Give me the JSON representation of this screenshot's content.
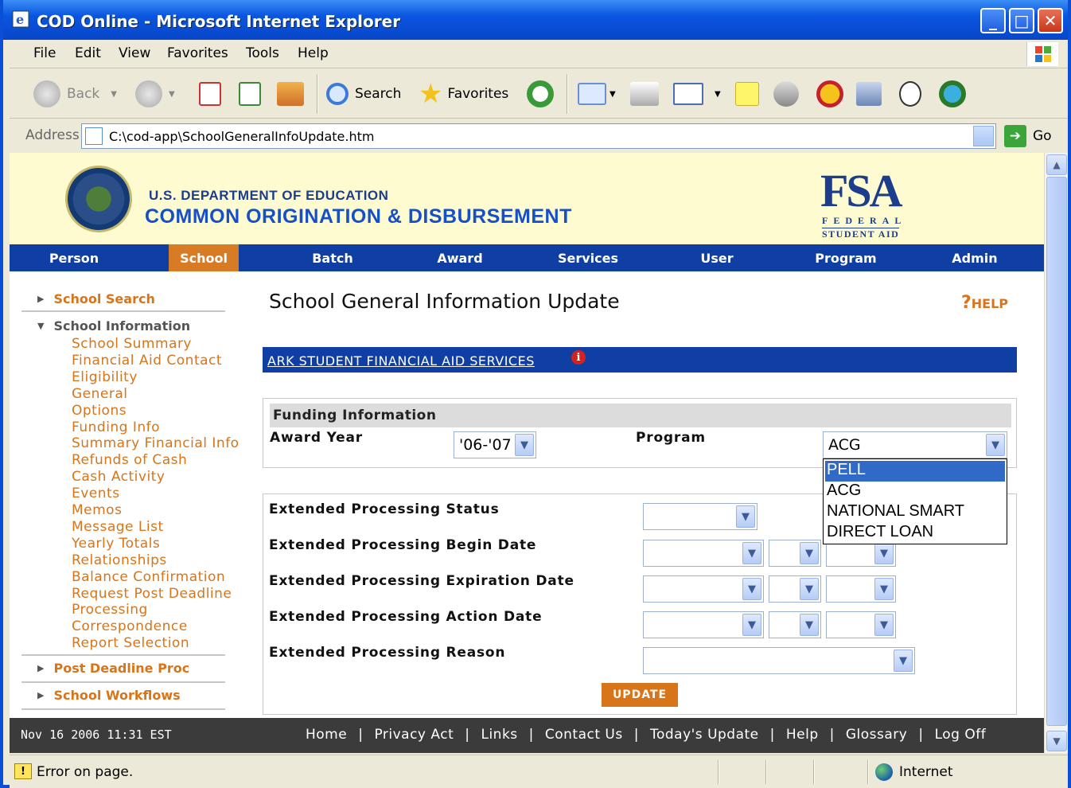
{
  "window": {
    "title": "COD Online - Microsoft Internet Explorer"
  },
  "menu": [
    "File",
    "Edit",
    "View",
    "Favorites",
    "Tools",
    "Help"
  ],
  "toolbar": {
    "back": "Back",
    "search": "Search",
    "favorites": "Favorites"
  },
  "address": {
    "label": "Address",
    "url": "C:\\cod-app\\SchoolGeneralInfoUpdate.htm",
    "go": "Go"
  },
  "banner": {
    "dept": "U.S. DEPARTMENT OF EDUCATION",
    "cod": "COMMON ORIGINATION & DISBURSEMENT",
    "fsa_big": "FSA",
    "fsa_federal": "FEDERAL",
    "fsa_student_aid": "STUDENT AID"
  },
  "nav": [
    "Person",
    "School",
    "Batch",
    "Award",
    "Services",
    "User",
    "Program",
    "Admin"
  ],
  "sidebar": {
    "school_search": "School Search",
    "school_information": "School Information",
    "items": [
      "School Summary",
      "Financial Aid Contact",
      "Eligibility",
      "General",
      "Options",
      "Funding Info",
      "Summary Financial Info",
      "Refunds of Cash",
      "Cash Activity",
      "Events",
      "Memos",
      "Message List",
      "Yearly Totals",
      "Relationships",
      "Balance Confirmation",
      "Request Post Deadline",
      "Processing",
      "Correspondence",
      "Report Selection"
    ],
    "post_deadline": "Post Deadline Proc",
    "school_workflows": "School Workflows"
  },
  "main": {
    "title": "School General Information Update",
    "help": "HELP",
    "school_name": "ARK STUDENT FINANCIAL AID SERVICES",
    "funding_header": "Funding Information",
    "award_year_label": "Award Year",
    "award_year_value": "'06-'07",
    "program_label": "Program",
    "program_value": "ACG",
    "program_options": [
      "PELL",
      "ACG",
      "NATIONAL SMART",
      "DIRECT LOAN"
    ],
    "ep_status": "Extended Processing Status",
    "ep_begin": "Extended Processing Begin Date",
    "ep_expire": "Extended Processing Expiration Date",
    "ep_action": "Extended Processing Action Date",
    "ep_reason": "Extended Processing Reason",
    "update": "UPDATE"
  },
  "footer": {
    "date": "Nov 16 2006 11:31 EST",
    "links": [
      "Home",
      "Privacy Act",
      "Links",
      "Contact Us",
      "Today's Update",
      "Help",
      "Glossary",
      "Log Off"
    ]
  },
  "status": {
    "message": "Error on page.",
    "zone": "Internet"
  },
  "colors": {
    "nav_blue": "#0f3fa3",
    "orange": "#d87b25",
    "banner": "#fffbd1"
  }
}
